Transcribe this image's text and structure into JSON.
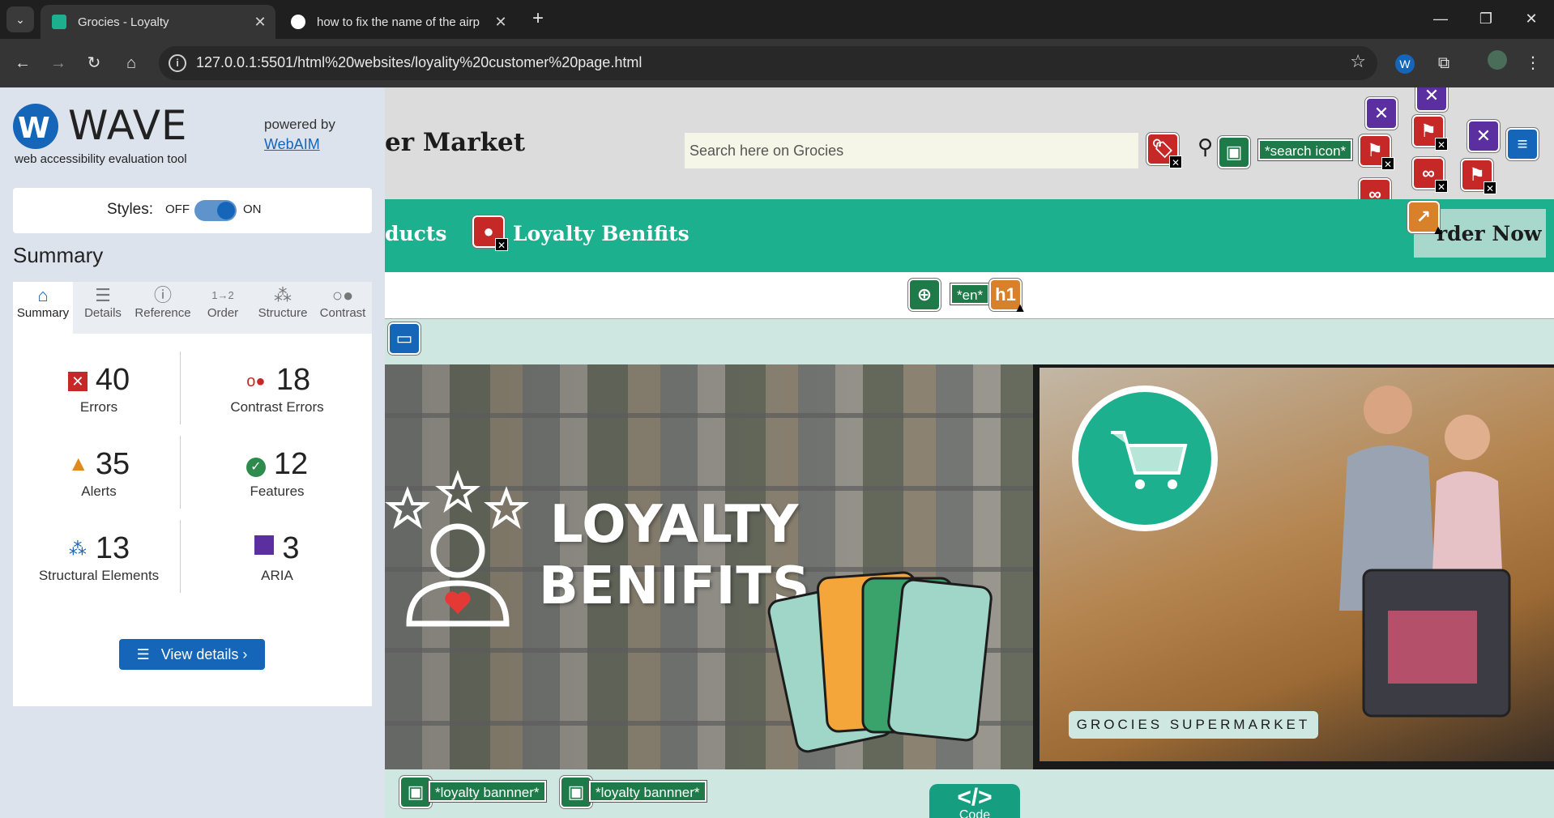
{
  "browser": {
    "tabs": [
      {
        "title": "Grocies - Loyalty",
        "active": true
      },
      {
        "title": "how to fix the name of the airp",
        "active": false
      }
    ],
    "url": "127.0.0.1:5501/html%20websites/loyality%20customer%20page.html"
  },
  "wave": {
    "logo_letter": "W",
    "name": "WAVE",
    "subtitle": "web accessibility evaluation tool",
    "powered_by": "powered by",
    "webaim": "WebAIM",
    "styles_label": "Styles:",
    "off_label": "OFF",
    "on_label": "ON",
    "summary_heading": "Summary",
    "tabs": [
      {
        "label": "Summary",
        "icon": "home-icon"
      },
      {
        "label": "Details",
        "icon": "list-icon"
      },
      {
        "label": "Reference",
        "icon": "info-icon"
      },
      {
        "label": "Order",
        "icon": "order-icon"
      },
      {
        "label": "Structure",
        "icon": "structure-icon"
      },
      {
        "label": "Contrast",
        "icon": "contrast-icon"
      }
    ],
    "stats": {
      "errors": {
        "count": "40",
        "label": "Errors"
      },
      "contrast": {
        "count": "18",
        "label": "Contrast Errors"
      },
      "alerts": {
        "count": "35",
        "label": "Alerts"
      },
      "features": {
        "count": "12",
        "label": "Features"
      },
      "structural": {
        "count": "13",
        "label": "Structural Elements"
      },
      "aria": {
        "count": "3",
        "label": "ARIA"
      }
    },
    "view_details": "View details ›"
  },
  "site": {
    "brand": "er Market",
    "search_placeholder": "Search here on Grocies",
    "search_alt": "*search icon*",
    "nav_products": "ducts",
    "nav_loyalty": "Loyalty Benifits",
    "order_now": "rder Now",
    "lang_label": "*en*",
    "h1_badge": "h1",
    "hero_line1": "LOYALTY",
    "hero_line2": "BENIFITS",
    "store_label": "GROCIES SUPERMARKET",
    "banner_alt_1": "*loyalty bannner*",
    "banner_alt_2": "*loyalty bannner*",
    "code_symbol": "</>",
    "code_label": "Code"
  },
  "colors": {
    "wave_blue": "#1565b8",
    "site_green": "#1db08e",
    "error_red": "#c62828",
    "feature_green": "#1e7a48"
  }
}
